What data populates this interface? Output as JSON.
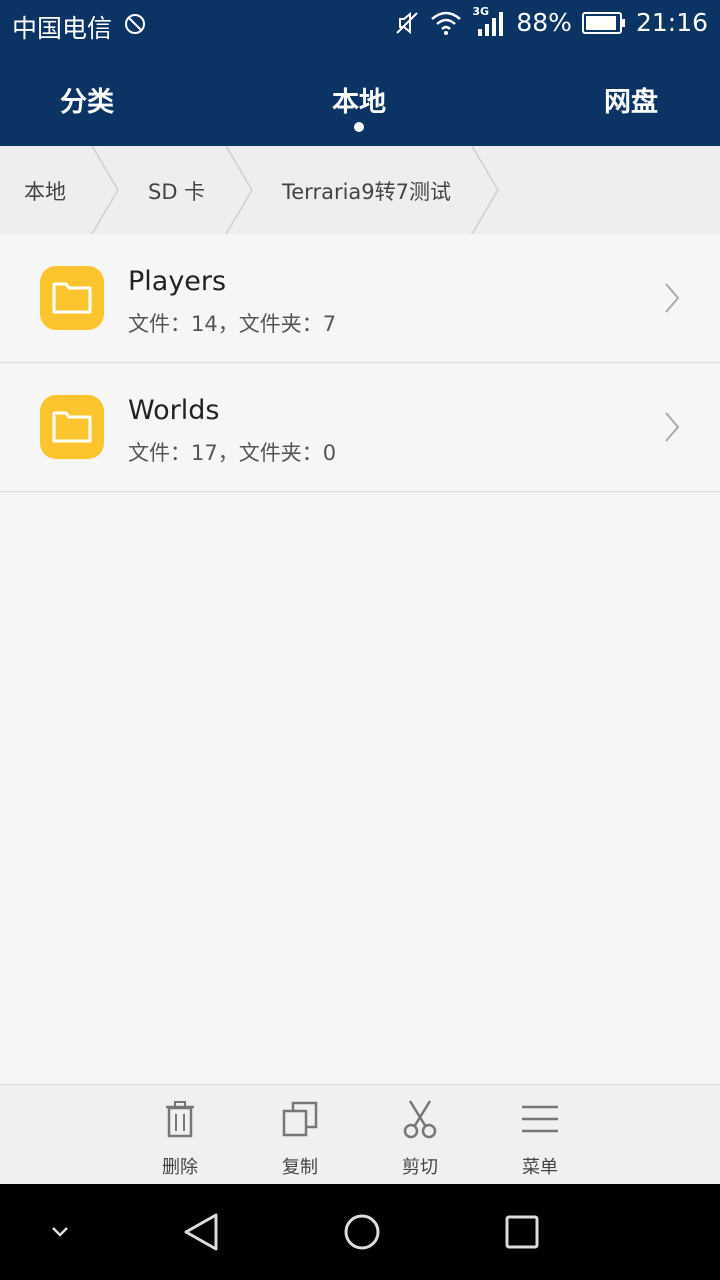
{
  "status_bar": {
    "carrier": "中国电信",
    "network": "3G",
    "battery": "88%",
    "time": "21:16"
  },
  "tabs": [
    {
      "label": "分类",
      "active": false
    },
    {
      "label": "本地",
      "active": true
    },
    {
      "label": "网盘",
      "active": false
    }
  ],
  "breadcrumb": [
    "本地",
    "SD 卡",
    "Terraria9转7测试"
  ],
  "folders": [
    {
      "name": "Players",
      "info": "文件：14，文件夹：7"
    },
    {
      "name": "Worlds",
      "info": "文件：17，文件夹：0"
    }
  ],
  "actions": [
    {
      "label": "删除",
      "icon": "trash-icon"
    },
    {
      "label": "复制",
      "icon": "copy-icon"
    },
    {
      "label": "剪切",
      "icon": "scissors-icon"
    },
    {
      "label": "菜单",
      "icon": "menu-icon"
    }
  ],
  "colors": {
    "header": "#0b3464",
    "folder": "#fcc52f",
    "background": "#f6f6f6"
  }
}
